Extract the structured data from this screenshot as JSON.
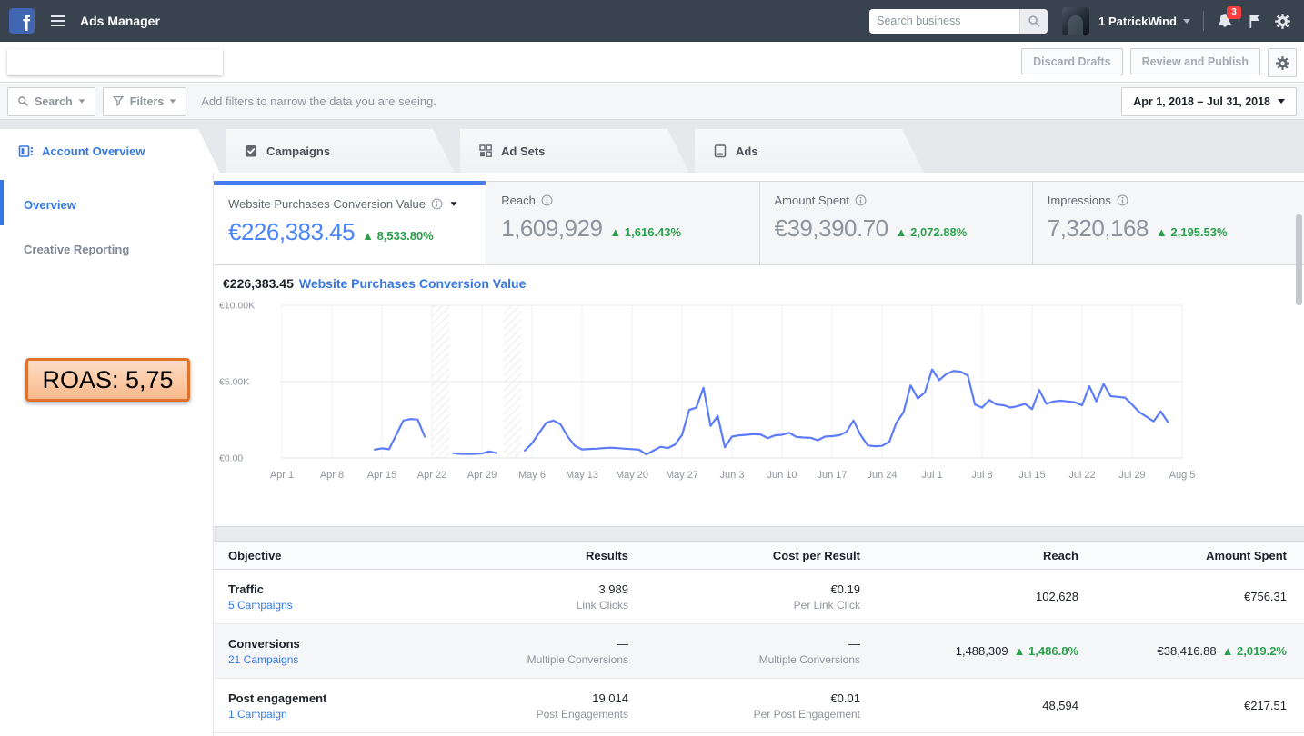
{
  "navbar": {
    "app_title": "Ads Manager",
    "search_placeholder": "Search business",
    "user_name": "1 PatrickWind",
    "notification_count": "3"
  },
  "toolbar": {
    "discard_label": "Discard Drafts",
    "review_label": "Review and Publish"
  },
  "filter_bar": {
    "search_label": "Search",
    "filters_label": "Filters",
    "hint": "Add filters to narrow the data you are seeing.",
    "date_range": "Apr 1, 2018 – Jul 31, 2018"
  },
  "tabs": [
    {
      "label": "Account Overview",
      "active": true
    },
    {
      "label": "Campaigns",
      "active": false
    },
    {
      "label": "Ad Sets",
      "active": false
    },
    {
      "label": "Ads",
      "active": false
    }
  ],
  "sidebar": {
    "items": [
      {
        "label": "Overview",
        "active": true
      },
      {
        "label": "Creative Reporting",
        "active": false
      }
    ]
  },
  "roas_overlay": {
    "text": "ROAS: 5,75",
    "border_color": "#e0732c"
  },
  "metric_cards": [
    {
      "label": "Website Purchases Conversion Value",
      "value": "€226,383.45",
      "delta": "▲ 8,533.80%",
      "active": true
    },
    {
      "label": "Reach",
      "value": "1,609,929",
      "delta": "▲ 1,616.43%",
      "active": false
    },
    {
      "label": "Amount Spent",
      "value": "€39,390.70",
      "delta": "▲ 2,072.88%",
      "active": false
    },
    {
      "label": "Impressions",
      "value": "7,320,168",
      "delta": "▲ 2,195.53%",
      "active": false
    }
  ],
  "chart_header": {
    "total": "€226,383.45",
    "metric": "Website Purchases Conversion Value"
  },
  "chart_data": {
    "type": "line",
    "title": "Website Purchases Conversion Value",
    "total_label": "€226,383.45",
    "currency": "EUR",
    "line_color": "#5c7cfa",
    "ylim": [
      0,
      10000
    ],
    "y_ticks": [
      {
        "v": 0,
        "label": "€0.00"
      },
      {
        "v": 5000,
        "label": "€5.00K"
      },
      {
        "v": 10000,
        "label": "€10.00K"
      }
    ],
    "x_domain_days": [
      0,
      126
    ],
    "x_labels": [
      "Apr 1",
      "Apr 8",
      "Apr 15",
      "Apr 22",
      "Apr 29",
      "May 6",
      "May 13",
      "May 20",
      "May 27",
      "Jun 3",
      "Jun 10",
      "Jun 17",
      "Jun 24",
      "Jul 1",
      "Jul 8",
      "Jul 15",
      "Jul 22",
      "Jul 29",
      "Aug 5"
    ],
    "gap_bands_days": [
      [
        21,
        23.5
      ],
      [
        31,
        33.5
      ]
    ],
    "points": [
      [
        13,
        550
      ],
      [
        14,
        630
      ],
      [
        15,
        570
      ],
      [
        16,
        1500
      ],
      [
        17,
        2450
      ],
      [
        18,
        2550
      ],
      [
        19,
        2520
      ],
      [
        20,
        1400
      ],
      [
        24,
        310
      ],
      [
        25,
        270
      ],
      [
        26,
        255
      ],
      [
        27,
        265
      ],
      [
        28,
        295
      ],
      [
        29,
        430
      ],
      [
        30,
        320
      ],
      [
        34,
        480
      ],
      [
        35,
        950
      ],
      [
        36,
        1650
      ],
      [
        37,
        2300
      ],
      [
        38,
        2450
      ],
      [
        39,
        2200
      ],
      [
        40,
        1400
      ],
      [
        41,
        800
      ],
      [
        42,
        560
      ],
      [
        43,
        590
      ],
      [
        44,
        610
      ],
      [
        45,
        640
      ],
      [
        46,
        670
      ],
      [
        47,
        640
      ],
      [
        48,
        610
      ],
      [
        49,
        580
      ],
      [
        50,
        540
      ],
      [
        51,
        230
      ],
      [
        52,
        480
      ],
      [
        53,
        730
      ],
      [
        54,
        650
      ],
      [
        55,
        870
      ],
      [
        56,
        1500
      ],
      [
        57,
        3150
      ],
      [
        58,
        3300
      ],
      [
        59,
        4600
      ],
      [
        60,
        2100
      ],
      [
        61,
        2750
      ],
      [
        62,
        700
      ],
      [
        63,
        1400
      ],
      [
        64,
        1480
      ],
      [
        65,
        1520
      ],
      [
        66,
        1560
      ],
      [
        67,
        1540
      ],
      [
        68,
        1300
      ],
      [
        69,
        1480
      ],
      [
        70,
        1520
      ],
      [
        71,
        1650
      ],
      [
        72,
        1380
      ],
      [
        73,
        1340
      ],
      [
        74,
        1320
      ],
      [
        75,
        1160
      ],
      [
        76,
        1400
      ],
      [
        77,
        1430
      ],
      [
        78,
        1490
      ],
      [
        79,
        1700
      ],
      [
        80,
        2450
      ],
      [
        81,
        1500
      ],
      [
        82,
        820
      ],
      [
        83,
        770
      ],
      [
        84,
        790
      ],
      [
        85,
        1060
      ],
      [
        86,
        2300
      ],
      [
        87,
        3000
      ],
      [
        88,
        4750
      ],
      [
        89,
        3900
      ],
      [
        90,
        4300
      ],
      [
        91,
        5800
      ],
      [
        92,
        5100
      ],
      [
        93,
        5500
      ],
      [
        94,
        5700
      ],
      [
        95,
        5650
      ],
      [
        96,
        5400
      ],
      [
        97,
        3500
      ],
      [
        98,
        3300
      ],
      [
        99,
        3800
      ],
      [
        100,
        3500
      ],
      [
        101,
        3450
      ],
      [
        102,
        3300
      ],
      [
        103,
        3400
      ],
      [
        104,
        3550
      ],
      [
        105,
        3200
      ],
      [
        106,
        4450
      ],
      [
        107,
        3550
      ],
      [
        108,
        3700
      ],
      [
        109,
        3750
      ],
      [
        110,
        3700
      ],
      [
        111,
        3650
      ],
      [
        112,
        3450
      ],
      [
        113,
        4700
      ],
      [
        114,
        3700
      ],
      [
        115,
        4850
      ],
      [
        116,
        4050
      ],
      [
        117,
        4000
      ],
      [
        118,
        3950
      ],
      [
        119,
        3500
      ],
      [
        120,
        3000
      ],
      [
        121,
        2700
      ],
      [
        122,
        2400
      ],
      [
        123,
        3050
      ],
      [
        124,
        2350
      ]
    ]
  },
  "table": {
    "headers": [
      "Objective",
      "Results",
      "Cost per Result",
      "Reach",
      "Amount Spent"
    ],
    "rows": [
      {
        "objective": "Traffic",
        "campaigns": "5 Campaigns",
        "results": "3,989",
        "results_sub": "Link Clicks",
        "cost": "€0.19",
        "cost_sub": "Per Link Click",
        "reach": "102,628",
        "spent": "€756.31"
      },
      {
        "objective": "Conversions",
        "campaigns": "21 Campaigns",
        "results": "—",
        "results_sub": "Multiple Conversions",
        "cost": "—",
        "cost_sub": "Multiple Conversions",
        "reach": "1,488,309",
        "reach_delta": "▲ 1,486.8%",
        "spent": "€38,416.88",
        "spent_delta": "▲ 2,019.2%"
      },
      {
        "objective": "Post engagement",
        "campaigns": "1 Campaign",
        "results": "19,014",
        "results_sub": "Post Engagements",
        "cost": "€0.01",
        "cost_sub": "Per Post Engagement",
        "reach": "48,594",
        "spent": "€217.51"
      }
    ]
  }
}
